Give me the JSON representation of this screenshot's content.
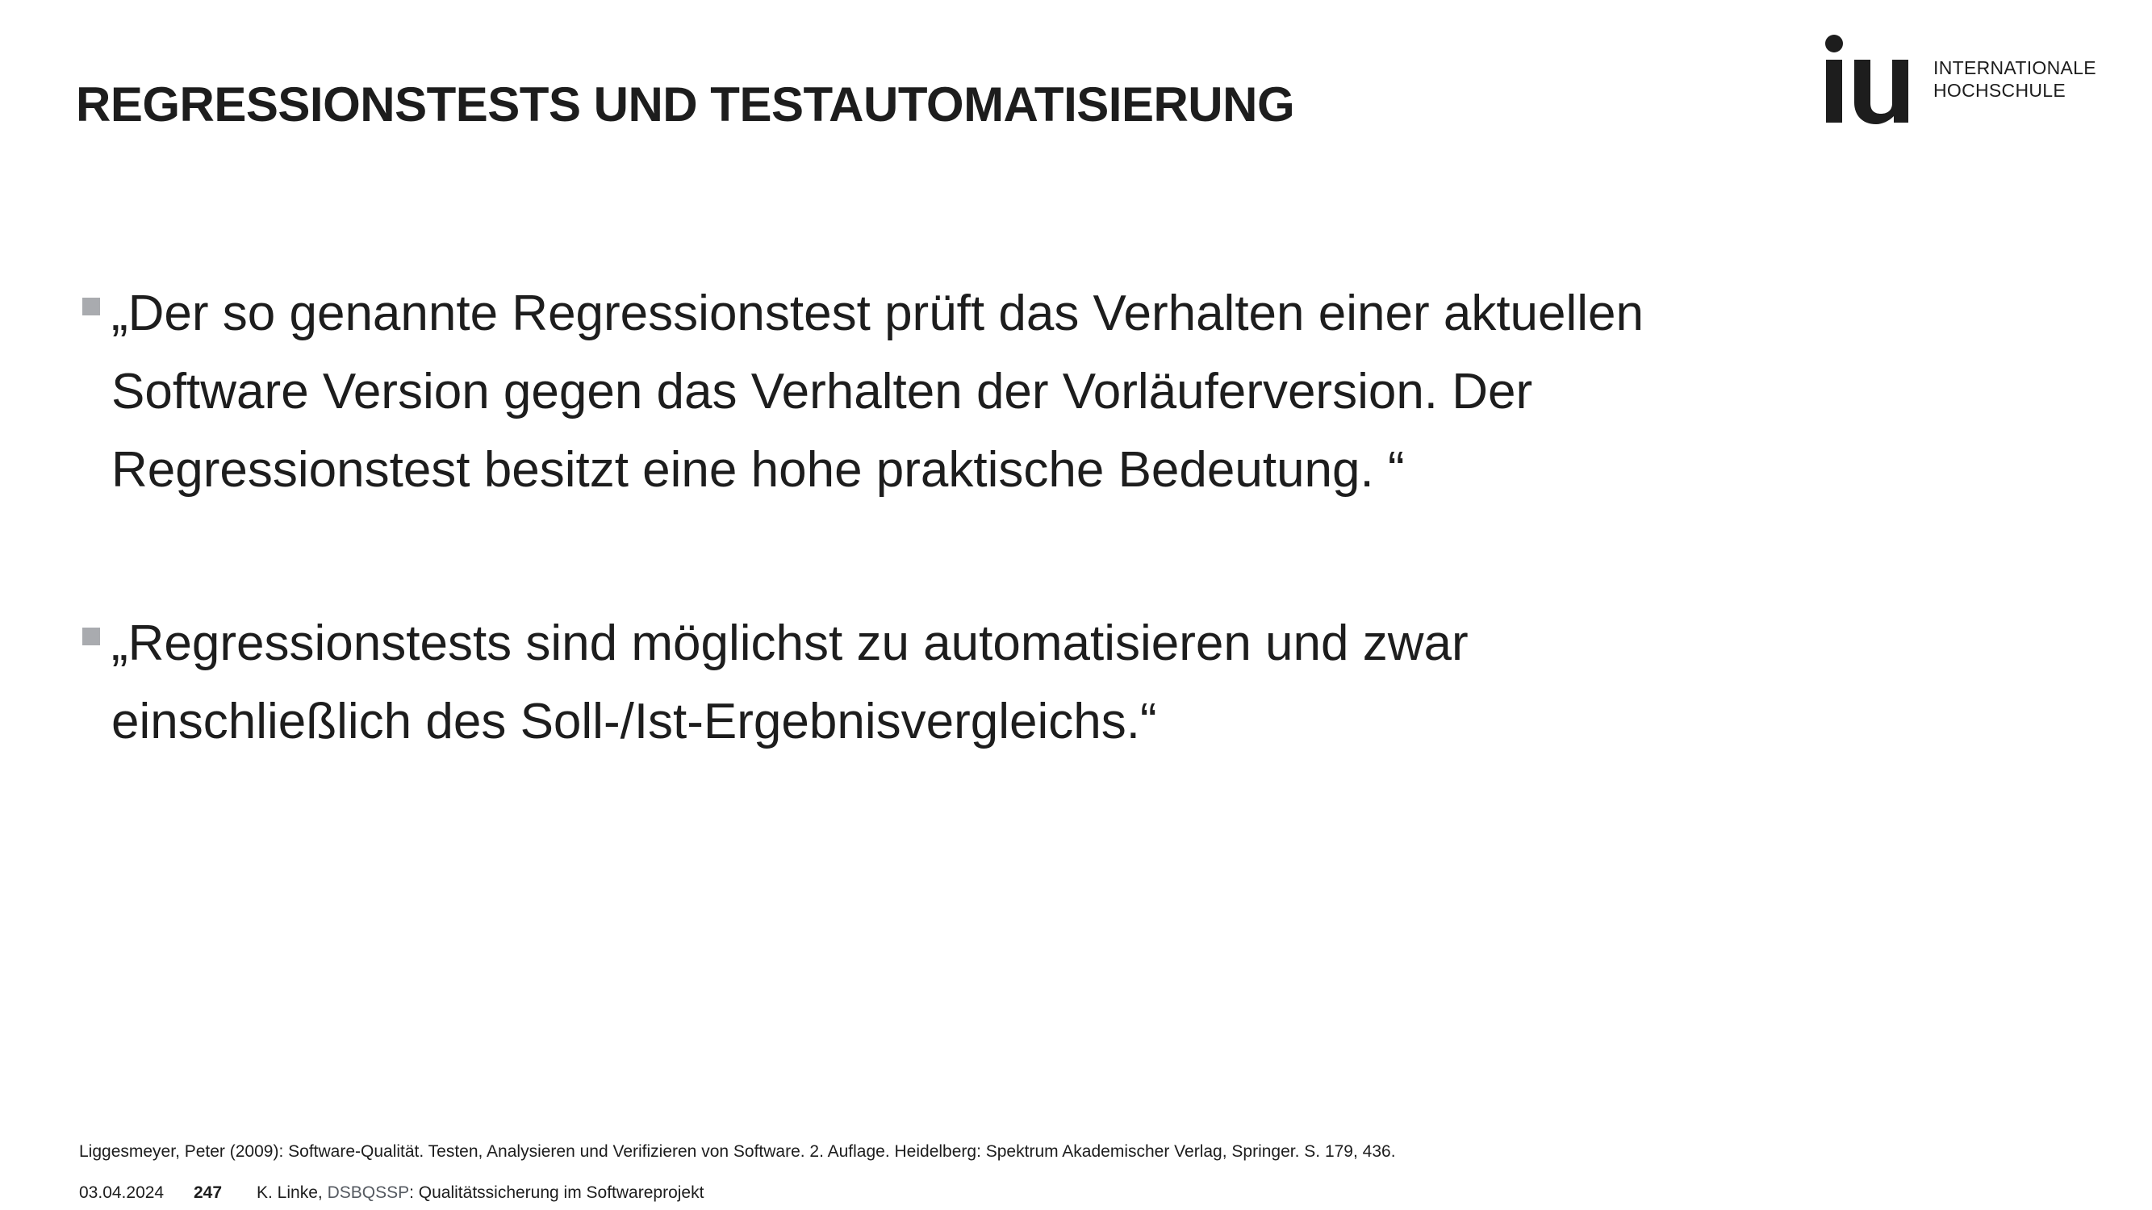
{
  "header": {
    "title": "REGRESSIONSTESTS UND TESTAUTOMATISIERUNG"
  },
  "logo": {
    "mark": "iu",
    "line1": "INTERNATIONALE",
    "line2": "HOCHSCHULE"
  },
  "bullets": [
    {
      "text": "„Der so genannte Regressionstest prüft das Verhalten einer aktuellen Software Version gegen das Verhalten der Vorläuferversion. Der Regressionstest besitzt eine hohe praktische Bedeutung. “"
    },
    {
      "text": "„Regressionstests sind möglichst zu automatisieren und zwar einschließlich des Soll-/Ist-Ergebnisvergleichs.“"
    }
  ],
  "footnote": "Liggesmeyer, Peter (2009): Software-Qualität. Testen, Analysieren und Verifizieren von Software. 2. Auflage. Heidelberg: Spektrum Akademischer Verlag, Springer. S. 179, 436.",
  "footer": {
    "date": "03.04.2024",
    "page": "247",
    "author": "K. Linke,",
    "course_code": "DSBQSSP",
    "course_title": ": Qualitätssicherung im Softwareprojekt"
  },
  "colors": {
    "text": "#1d1d1d",
    "bullet_marker": "#a9abaf",
    "course_code": "#555a61",
    "background": "#ffffff"
  }
}
